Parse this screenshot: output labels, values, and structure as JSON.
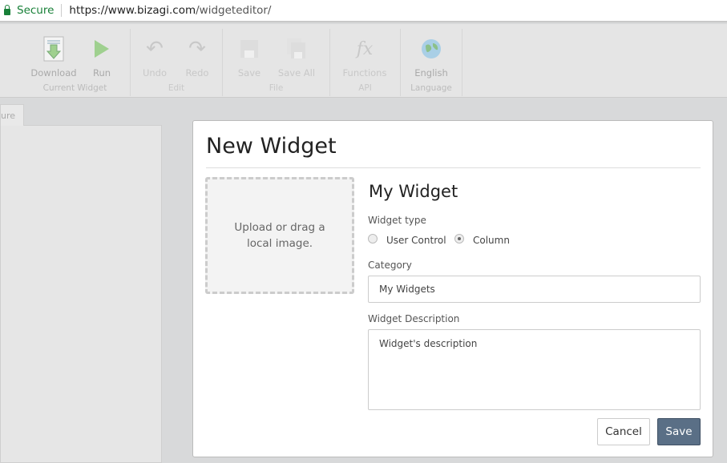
{
  "browser": {
    "secure": "Secure",
    "url_host": "https://www.bizagi.com",
    "url_path": "/widgeteditor/"
  },
  "toolbar": {
    "groups": [
      {
        "label": "Current Widget",
        "buttons": [
          {
            "label": "Download",
            "icon": "download-icon"
          },
          {
            "label": "Run",
            "icon": "play-icon"
          }
        ]
      },
      {
        "label": "Edit",
        "buttons": [
          {
            "label": "Undo",
            "icon": "undo-icon"
          },
          {
            "label": "Redo",
            "icon": "redo-icon"
          }
        ]
      },
      {
        "label": "File",
        "buttons": [
          {
            "label": "Save",
            "icon": "floppy-icon"
          },
          {
            "label": "Save All",
            "icon": "floppy-multiple-icon"
          }
        ]
      },
      {
        "label": "API",
        "buttons": [
          {
            "label": "Functions",
            "icon": "fx-icon"
          }
        ]
      },
      {
        "label": "Language",
        "buttons": [
          {
            "label": "English",
            "icon": "globe-icon"
          }
        ]
      }
    ]
  },
  "left_tab": "ure",
  "modal": {
    "title": "New Widget",
    "upload_text": "Upload or drag a local image.",
    "widget_name": "My Widget",
    "type_label": "Widget type",
    "type_options": [
      {
        "label": "User Control",
        "selected": false
      },
      {
        "label": "Column",
        "selected": true
      }
    ],
    "category_label": "Category",
    "category_value": "My Widgets",
    "description_label": "Widget Description",
    "description_value": "Widget's description",
    "cancel": "Cancel",
    "save": "Save",
    "save_color": "#5a6f86"
  }
}
